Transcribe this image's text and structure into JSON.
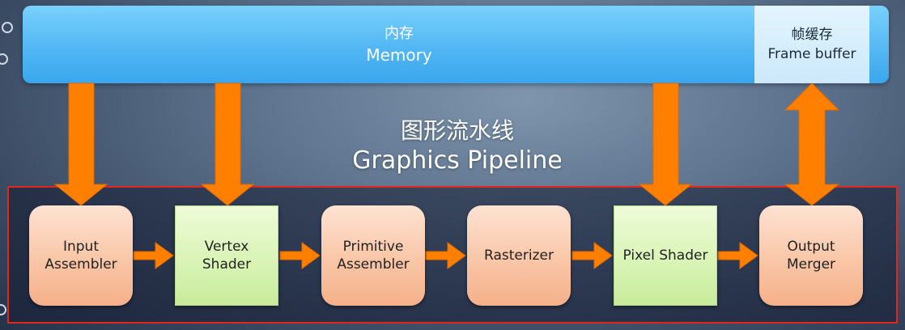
{
  "memory": {
    "label_zh": "内存",
    "label_en": "Memory",
    "color": "#4fb5f3"
  },
  "frame_buffer": {
    "label_zh": "帧缓存",
    "label_en": "Frame buffer",
    "color": "#d6eefc"
  },
  "pipeline_title": {
    "zh": "图形流水线",
    "en": "Graphics Pipeline"
  },
  "stages": [
    {
      "label": "Input\nAssembler",
      "style": "orange"
    },
    {
      "label": "Vertex\nShader",
      "style": "green"
    },
    {
      "label": "Primitive\nAssembler",
      "style": "orange"
    },
    {
      "label": "Rasterizer",
      "style": "orange"
    },
    {
      "label": "Pixel Shader",
      "style": "green"
    },
    {
      "label": "Output\nMerger",
      "style": "orange"
    }
  ],
  "colors": {
    "arrow": "#ff8000",
    "frame_border": "#e2261c"
  }
}
